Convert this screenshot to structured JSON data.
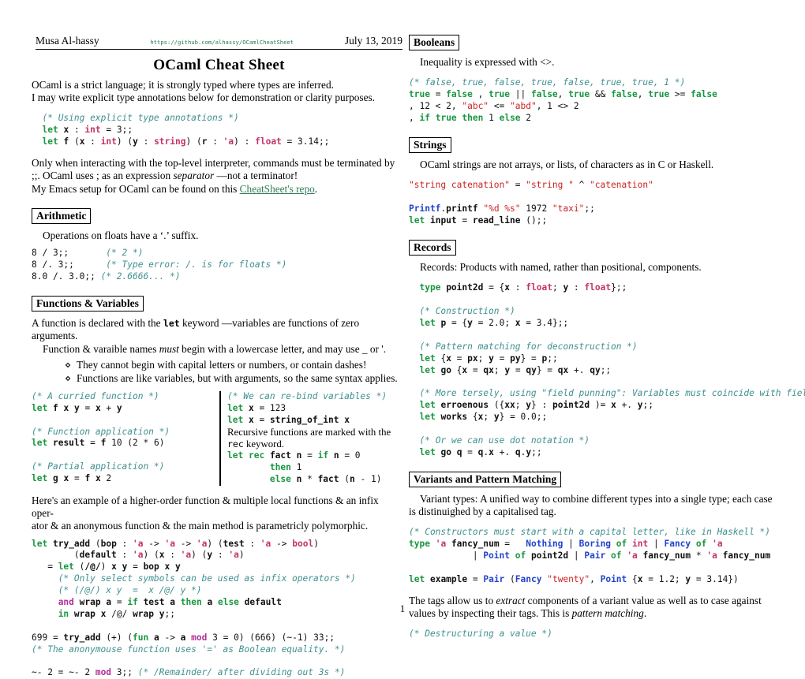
{
  "header": {
    "author": "Musa Al-hassy",
    "url": "https://github.com/alhassy/OCamlCheatSheet",
    "date": "July 13, 2019"
  },
  "title": "OCaml Cheat Sheet",
  "page_number": "1",
  "colors": {
    "comment": "#3f8f8f",
    "keyword_green": "#1a9641",
    "keyword_magenta": "#b3309a",
    "type": "#c4336b",
    "string": "#cc2222",
    "module": "#2244cc",
    "link": "#2f7d57"
  },
  "left": {
    "intro_line1": "OCaml is a strict language; it is strongly typed where types are inferred.",
    "intro_line2": "I may write explicit type annotations below for demonstration or clarity purposes.",
    "code_annotations": {
      "l1": "(* Using explicit type annotations *)",
      "l2": "let x : int = 3;;",
      "l3": "let f (x : int) (y : string) (r : 'a) : float = 3.14;;"
    },
    "toplevel_p1": "Only when interacting with the top-level interpreter, commands must be terminated by",
    "toplevel_p2_a": ";;. OCaml uses ; as an expression ",
    "toplevel_p2_em": "separator",
    "toplevel_p2_b": " —not a terminator!",
    "toplevel_p3_a": "My Emacs setup for OCaml can be found on this ",
    "toplevel_p3_link": "CheatSheet's repo",
    "toplevel_p3_b": ".",
    "arithmetic": {
      "title": "Arithmetic",
      "desc": "Operations on floats have a ‘.’ suffix.",
      "l1_code": "8 / 3;;",
      "l1_comment": "(* 2 *)",
      "l2_code": "8 /. 3;;",
      "l2_comment": "(* Type error: /. is for floats *)",
      "l3_code": "8.0 /. 3.0;;",
      "l3_comment": "(* 2.6666... *)"
    },
    "functions": {
      "title": "Functions & Variables",
      "p1_a": "A function is declared with the ",
      "p1_kw": "let",
      "p1_b": " keyword —variables are functions of zero arguments.",
      "p2_a": "Function & varaible names ",
      "p2_em": "must",
      "p2_b": " begin with a lowercase letter, and may use _ or '.",
      "bullets": [
        "They cannot begin with capital letters or numbers, or contain dashes!",
        "Functions are like variables, but with arguments, so the same syntax applies."
      ],
      "left_code": {
        "c1": "(* A curried function *)",
        "l1": "let f x y = x + y",
        "c2": "(* Function application *)",
        "l2": "let result = f 10 (2 * 6)",
        "c3": "(* Partial application *)",
        "l3": "let g x = f x 2"
      },
      "right_code": {
        "c1": "(* We can re-bind variables *)",
        "l1": "let x = 123",
        "l2": "let x = string_of_int x",
        "prose1": "Recursive functions are marked with the",
        "prose2_kw": "rec",
        "prose2": " keyword.",
        "l3": "let rec fact n = if n = 0",
        "l4": "then 1",
        "l5": "else n * fact (n - 1)"
      },
      "ho_p1": "Here's an example of a higher-order function & multiple local functions & an infix oper-",
      "ho_p2": "ator & an anonymous function & the main method is parametricly polymorphic.",
      "try_add": {
        "l1": "let try_add (bop : 'a -> 'a -> 'a) (test : 'a -> bool)",
        "l2": "(default : 'a) (x : 'a) (y : 'a)",
        "l3": "= let (/@/) x y = bop x y",
        "l4": "(* Only select symbols can be used as infix operators *)",
        "l5": "(* (/@/) x y  =  x /@/ y *)",
        "l6": "and wrap a = if test a then a else default",
        "l7": "in wrap x /@/ wrap y;;",
        "l8": "699 = try_add (+) (fun a -> a mod 3 = 0) (666) (~-1) 33;;",
        "l9": "(* The anonymouse function uses '=' as Boolean equality. *)",
        "l10": "~- 2 = ~- 2 mod 3;; (* /Remainder/ after dividing out 3s *)"
      }
    }
  },
  "right": {
    "booleans": {
      "title": "Booleans",
      "desc": "Inequality is expressed with <>.",
      "c1": "(* false, true, false, true, false, true, true, 1 *)",
      "l1": "true = false , true || false, true && false, true >= false",
      "l2": ", 12 < 2, \"abc\" <= \"abd\", 1 <> 2",
      "l3": ", if true then 1 else 2"
    },
    "strings": {
      "title": "Strings",
      "desc": "OCaml strings are not arrays, or lists, of characters as in C or Haskell.",
      "l1": "\"string catenation\" = \"string \" ^ \"catenation\"",
      "l2": "Printf.printf \"%d %s\" 1972 \"taxi\";;",
      "l3": "let input = read_line ();;"
    },
    "records": {
      "title": "Records",
      "desc": "Records: Products with named, rather than positional, components.",
      "l1": "type point2d = {x : float; y : float};;",
      "c2": "(* Construction *)",
      "l2": "let p = {y = 2.0; x = 3.4};;",
      "c3": "(* Pattern matching for deconstruction *)",
      "l3": "let {x = px; y = py} = p;;",
      "l4": "let go {x = qx; y = qy} = qx +. qy;;",
      "c4": "(* More tersely, using \"field punning\": Variables must coincide with field names. *)",
      "l5": "let erroenous ({xx; y} : point2d )= x +. y;;",
      "l6": "let works {x; y} = 0.0;;",
      "c5": "(* Or we can use dot notation *)",
      "l7": "let go q = q.x +. q.y;;"
    },
    "variants": {
      "title": "Variants and Pattern Matching",
      "desc1": "Variant types: A unified way to combine different types into a single type; each case",
      "desc2": "is distinuighed by a capitalised tag.",
      "c1": "(* Constructors must start with a capital letter, like in Haskell *)",
      "l1": "type 'a fancy_num =   Nothing | Boring of int | Fancy of 'a",
      "l2": "| Point of point2d | Pair of 'a fancy_num * 'a fancy_num",
      "l3": "let example = Pair (Fancy \"twenty\", Point {x = 1.2; y = 3.14})",
      "tags_p1_a": "The tags allow us to ",
      "tags_p1_em": "extract",
      "tags_p1_b": " components of a variant value as well as to case against",
      "tags_p2_a": "values by inspecting their tags. This is ",
      "tags_p2_em": "pattern matching",
      "tags_p2_b": ".",
      "c2": "(* Destructuring a value *)"
    }
  }
}
